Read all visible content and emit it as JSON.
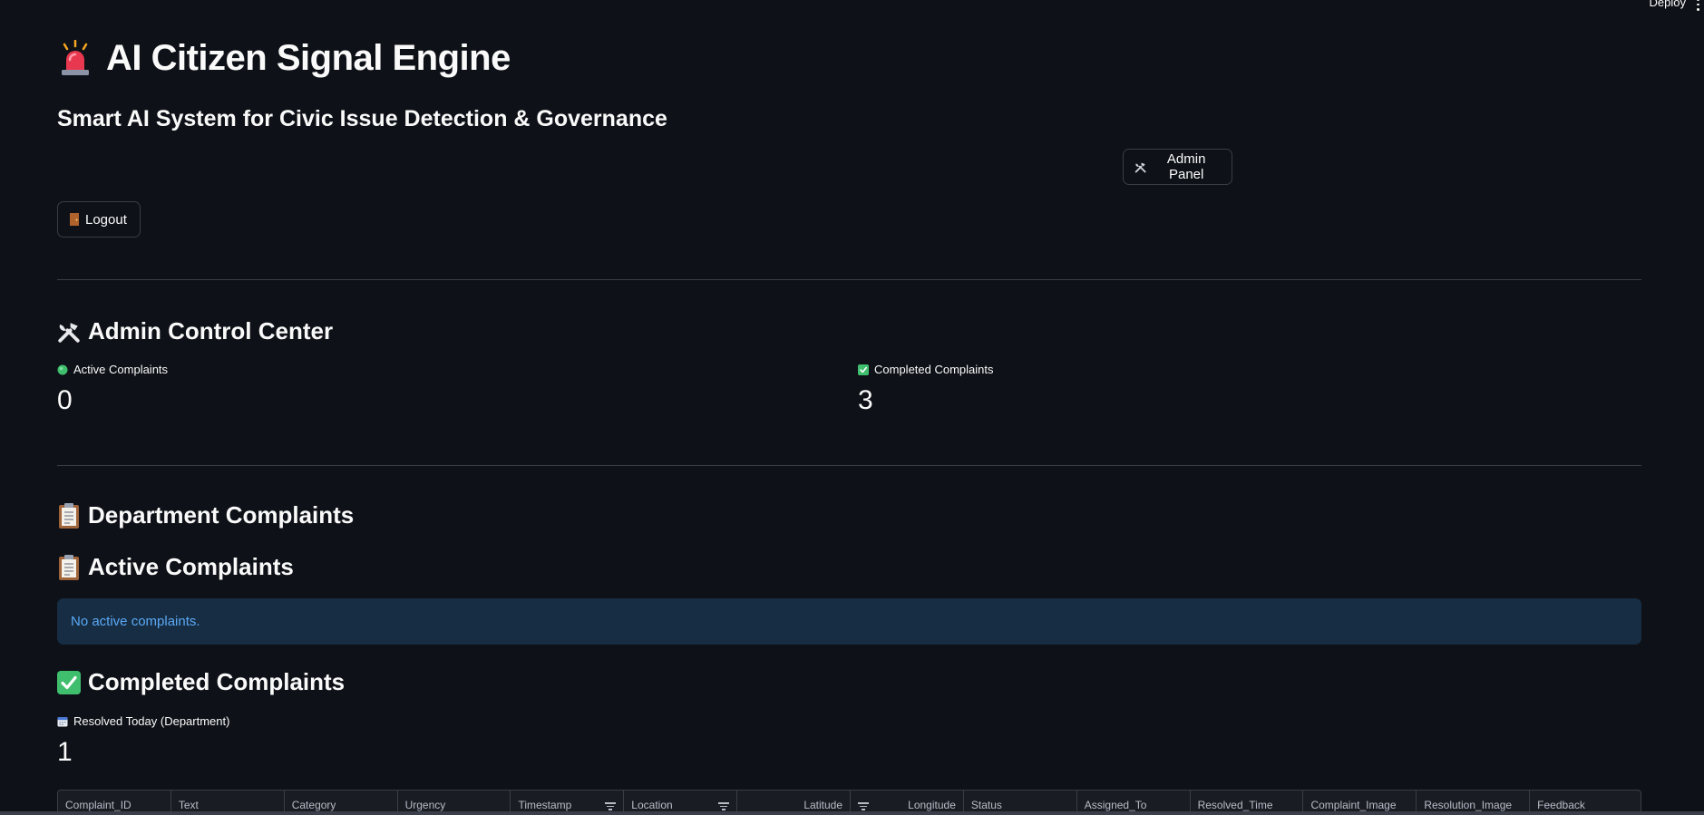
{
  "header": {
    "deploy_label": "Deploy",
    "menu_icon": "kebab-menu-icon"
  },
  "app": {
    "title": "AI Citizen Signal Engine",
    "title_icon": "siren-icon",
    "subtitle": "Smart AI System for Civic Issue Detection & Governance"
  },
  "buttons": {
    "admin_panel": "Admin Panel",
    "logout": "Logout"
  },
  "admin_center": {
    "heading": "Admin Control Center",
    "metrics": {
      "active_label": "Active Complaints",
      "active_value": "0",
      "completed_label": "Completed Complaints",
      "completed_value": "3"
    }
  },
  "department": {
    "heading": "Department Complaints",
    "active_heading": "Active Complaints",
    "active_info": "No active complaints.",
    "completed_heading": "Completed Complaints",
    "resolved_today_label": "Resolved Today (Department)",
    "resolved_today_value": "1"
  },
  "table": {
    "columns": [
      "Complaint_ID",
      "Text",
      "Category",
      "Urgency",
      "Timestamp",
      "Location",
      "Latitude",
      "Longitude",
      "Status",
      "Assigned_To",
      "Resolved_Time",
      "Complaint_Image",
      "Resolution_Image",
      "Feedback"
    ]
  },
  "colors": {
    "background": "#0e1117",
    "info_bg": "#172d43",
    "info_text": "#5aa9f5",
    "divider": "#3a3d46"
  }
}
